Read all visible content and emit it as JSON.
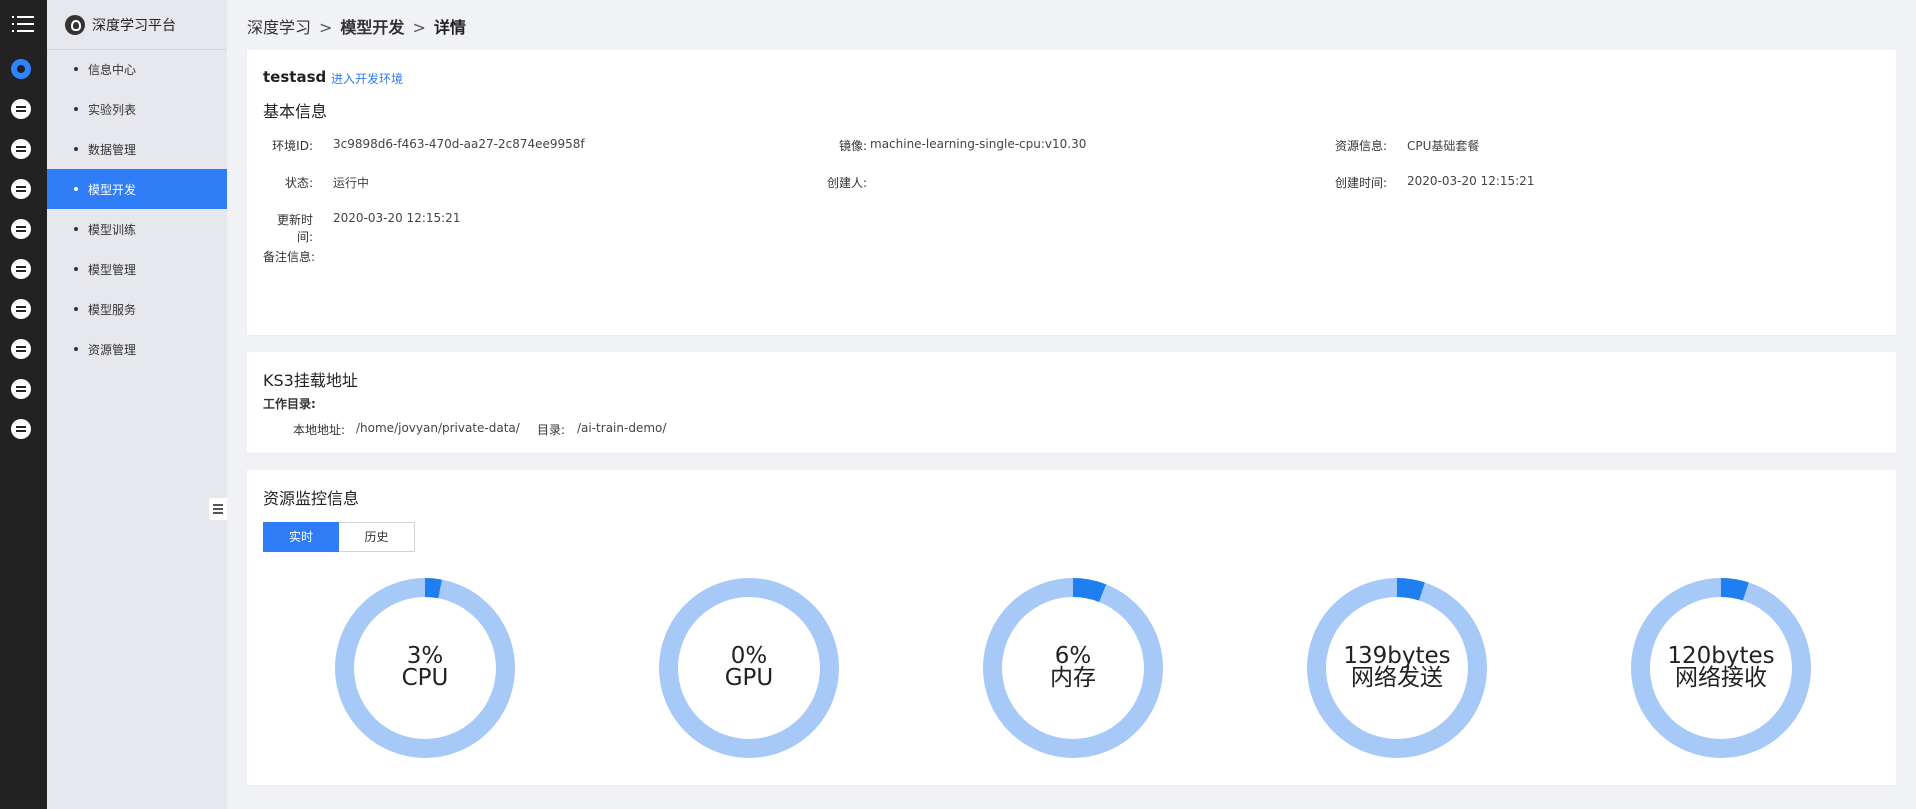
{
  "brand": {
    "title": "深度学习平台"
  },
  "rail": {
    "icons": [
      "menu-icon",
      "info-center-icon",
      "experiment-icon",
      "data-icon",
      "model-dev-icon",
      "training-icon",
      "model-manage-icon",
      "service-icon",
      "resource-icon",
      "mail-icon",
      "id-card-icon"
    ]
  },
  "sidebar": {
    "items": [
      {
        "label": "信息中心",
        "active": false
      },
      {
        "label": "实验列表",
        "active": false
      },
      {
        "label": "数据管理",
        "active": false
      },
      {
        "label": "模型开发",
        "active": true
      },
      {
        "label": "模型训练",
        "active": false
      },
      {
        "label": "模型管理",
        "active": false
      },
      {
        "label": "模型服务",
        "active": false
      },
      {
        "label": "资源管理",
        "active": false
      }
    ]
  },
  "breadcrumb": {
    "items": [
      "深度学习",
      "模型开发",
      "详情"
    ],
    "separator": ">"
  },
  "basic": {
    "env_name": "testasd",
    "enter_link": "进入开发环境",
    "section_title": "基本信息",
    "fields": {
      "env_id": {
        "label": "环境ID:",
        "value": "3c9898d6-f463-470d-aa27-2c874ee9958f"
      },
      "image": {
        "label": "镜像:",
        "value": "machine-learning-single-cpu:v10.30"
      },
      "resource": {
        "label": "资源信息:",
        "value": "CPU基础套餐"
      },
      "status": {
        "label": "状态:",
        "value": "运行中"
      },
      "creator": {
        "label": "创建人:",
        "value": ""
      },
      "created_at": {
        "label": "创建时间:",
        "value": "2020-03-20 12:15:21"
      },
      "updated_at": {
        "label": "更新时间:",
        "value": "2020-03-20 12:15:21"
      },
      "remark": {
        "label": "备注信息:",
        "value": ""
      }
    }
  },
  "ks3": {
    "section_title": "KS3挂载地址",
    "workdir_label": "工作目录:",
    "local_label": "本地地址:",
    "local_value": "/home/jovyan/private-data/",
    "dir_label": "目录:",
    "dir_value": "/ai-train-demo/"
  },
  "monitor": {
    "section_title": "资源监控信息",
    "tabs": [
      {
        "label": "实时",
        "active": true
      },
      {
        "label": "历史",
        "active": false
      }
    ],
    "gauges": [
      {
        "value_text": "3%",
        "label": "CPU",
        "fraction": 0.03
      },
      {
        "value_text": "0%",
        "label": "GPU",
        "fraction": 0.0
      },
      {
        "value_text": "6%",
        "label": "内存",
        "fraction": 0.06
      },
      {
        "value_text": "139bytes",
        "label": "网络发送",
        "fraction": 0.05
      },
      {
        "value_text": "120bytes",
        "label": "网络接收",
        "fraction": 0.05
      }
    ]
  },
  "colors": {
    "accent": "#2e7cf6",
    "rail_bg": "#222222",
    "sidebar_bg": "#e7e8ed",
    "gauge_track": "#a7c9f7",
    "gauge_fill": "#1f7ef0"
  }
}
